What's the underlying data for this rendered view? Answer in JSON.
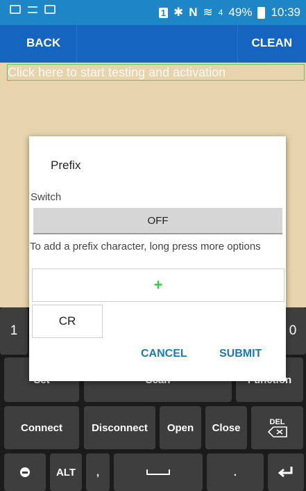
{
  "status_bar": {
    "notification_badge": "1",
    "signal_text": "4",
    "battery_percent": "49%",
    "time": "10:39",
    "icons": [
      "gallery-icon",
      "usb-icon",
      "clipboard-icon",
      "bluetooth-icon",
      "nfc-icon",
      "wifi-icon",
      "signal-icon",
      "battery-icon"
    ]
  },
  "app_bar": {
    "back_label": "BACK",
    "clean_label": "CLEAN"
  },
  "test_field": {
    "text": "Click here to start testing and activation"
  },
  "dialog": {
    "title": "Prefix",
    "switch_label": "Switch",
    "switch_value": "OFF",
    "hint": "To add a prefix character, long press more options",
    "add_symbol": "+",
    "chip_cr": "CR",
    "cancel_label": "CANCEL",
    "submit_label": "SUBMIT"
  },
  "keyboard": {
    "row1_left": "1",
    "row1_right": "0",
    "row2": [
      "Set",
      "Scan",
      "Function"
    ],
    "row3": [
      "Connect",
      "Disconnect",
      "Open",
      "Close"
    ],
    "del_label": "DEL",
    "alt_label": "ALT",
    "comma": ",",
    "period": "."
  }
}
